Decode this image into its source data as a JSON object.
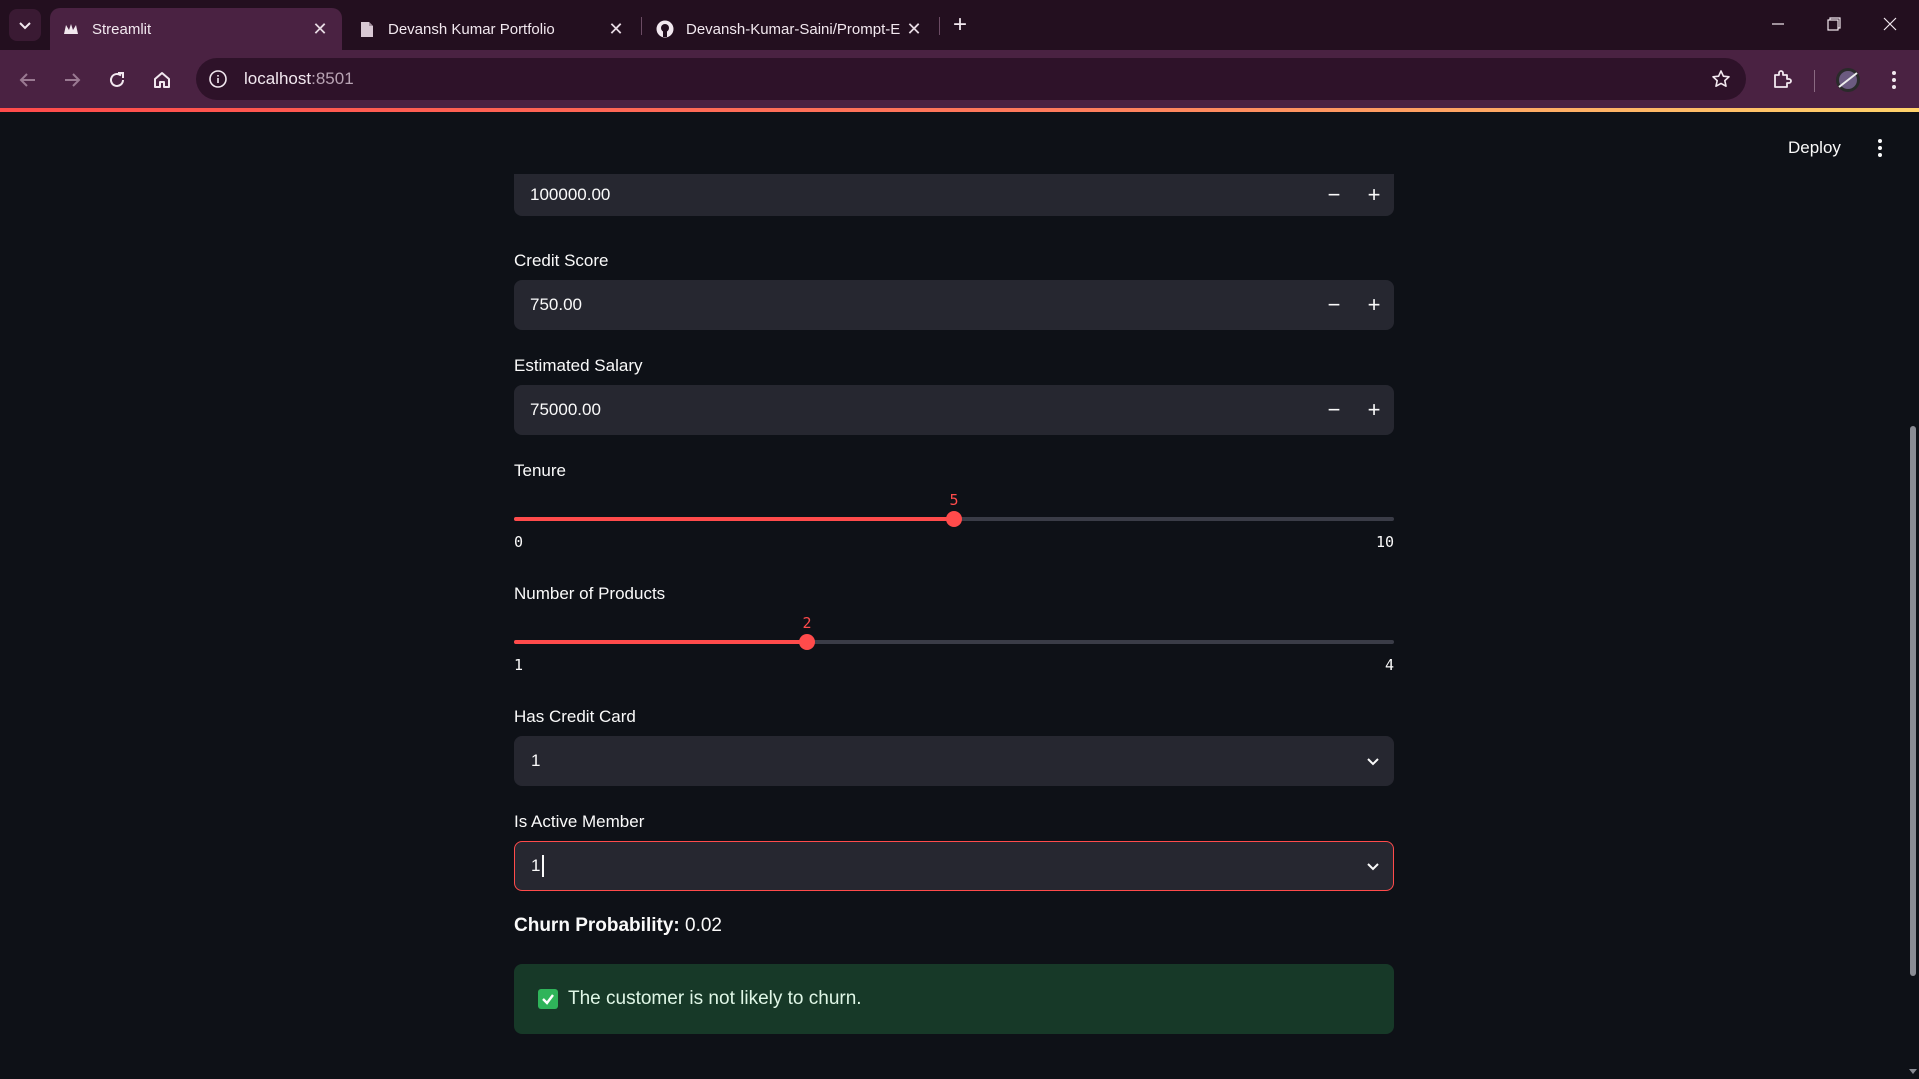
{
  "browser": {
    "tabs": [
      {
        "title": "Streamlit",
        "active": true,
        "icon": "streamlit-crown-icon"
      },
      {
        "title": "Devansh Kumar Portfolio",
        "active": false,
        "icon": "document-icon"
      },
      {
        "title": "Devansh-Kumar-Saini/Prompt-E",
        "active": false,
        "icon": "github-icon"
      }
    ],
    "url_host": "localhost",
    "url_port": ":8501"
  },
  "app": {
    "deploy_label": "Deploy",
    "inputs": {
      "balance_value": "100000.00",
      "credit_score_label": "Credit Score",
      "credit_score_value": "750.00",
      "salary_label": "Estimated Salary",
      "salary_value": "75000.00",
      "step_minus": "−",
      "step_plus": "+"
    },
    "sliders": {
      "tenure": {
        "label": "Tenure",
        "value": "5",
        "min": "0",
        "max": "10",
        "value_fraction": 0.5
      },
      "products": {
        "label": "Number of Products",
        "value": "2",
        "min": "1",
        "max": "4",
        "value_fraction": 0.3333
      }
    },
    "selects": {
      "has_credit_card": {
        "label": "Has Credit Card",
        "value": "1"
      },
      "is_active_member": {
        "label": "Is Active Member",
        "value": "1"
      }
    },
    "result": {
      "probability_label": "Churn Probability:",
      "probability_value": "0.02",
      "message": "The customer is not likely to churn."
    }
  },
  "colors": {
    "accent": "#ff4b4b",
    "success_bg": "#173928",
    "input_bg": "#262730",
    "app_bg": "#0e1117"
  }
}
